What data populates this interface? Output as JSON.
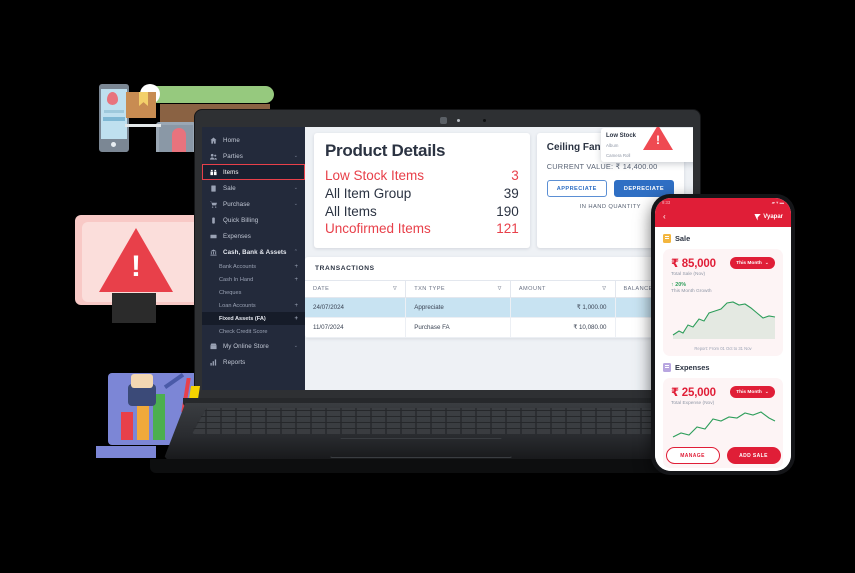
{
  "app": {
    "sidebar": {
      "items": [
        {
          "label": "Home",
          "icon": "home-icon",
          "chevron": ""
        },
        {
          "label": "Parties",
          "icon": "people-icon",
          "chevron": "⌄"
        },
        {
          "label": "Items",
          "icon": "items-icon",
          "chevron": "",
          "selected": true
        },
        {
          "label": "Sale",
          "icon": "sale-icon",
          "chevron": "⌄"
        },
        {
          "label": "Purchase",
          "icon": "cart-icon",
          "chevron": "⌄"
        },
        {
          "label": "Quick Billing",
          "icon": "billing-icon",
          "chevron": ""
        },
        {
          "label": "Expenses",
          "icon": "expenses-icon",
          "chevron": ""
        },
        {
          "label": "Cash, Bank & Assets",
          "icon": "bank-icon",
          "chevron": "⌃",
          "bold": true
        }
      ],
      "subitems": [
        {
          "label": "Bank Accounts",
          "plus": "+"
        },
        {
          "label": "Cash In Hand",
          "plus": "+"
        },
        {
          "label": "Cheques",
          "plus": ""
        },
        {
          "label": "Loan Accounts",
          "plus": "+"
        },
        {
          "label": "Fixed Assets (FA)",
          "plus": "+",
          "active": true
        },
        {
          "label": "Check Credit Score",
          "plus": ""
        }
      ],
      "footer_items": [
        {
          "label": "My Online Store",
          "icon": "store-icon",
          "chevron": "⌄"
        },
        {
          "label": "Reports",
          "icon": "reports-icon",
          "chevron": ""
        }
      ]
    },
    "product_details": {
      "title": "Product Details",
      "stats": [
        {
          "label": "Low Stock Items",
          "value": "3",
          "highlight": true
        },
        {
          "label": "All Item Group",
          "value": "39",
          "highlight": false
        },
        {
          "label": "All Items",
          "value": "190",
          "highlight": false
        },
        {
          "label": "Uncofirmed Items",
          "value": "121",
          "highlight": true
        }
      ]
    },
    "product_card": {
      "name": "Ceiling Fan",
      "current_value": "CURRENT VALUE: ₹ 14,400.00",
      "appreciate_label": "APPRECIATE",
      "depreciate_label": "DEPRECIATE",
      "in_hand_label": "IN HAND QUANTITY"
    },
    "low_stock_popup": {
      "title": "Low Stock",
      "star": "☆",
      "rows": [
        {
          "label": "Album",
          "dots": "⋮"
        },
        {
          "label": "Camera Roll",
          "dots": "⋮"
        }
      ]
    },
    "transactions": {
      "title": "TRANSACTIONS",
      "columns": [
        "DATE",
        "TXN TYPE",
        "AMOUNT",
        "BALANCE"
      ],
      "filter_glyph": "∇",
      "rows": [
        {
          "date": "24/07/2024",
          "type": "Appreciate",
          "amount": "₹ 1,000.00",
          "balance": "",
          "selected": true
        },
        {
          "date": "11/07/2024",
          "type": "Purchase FA",
          "amount": "₹ 10,080.00",
          "balance": "",
          "selected": false
        }
      ]
    }
  },
  "phone": {
    "status": {
      "time": "9:33",
      "icons": "▰ ▾ ▬"
    },
    "header": {
      "back": "‹",
      "brand": "Vyapar"
    },
    "sale": {
      "section_title": "Sale",
      "amount": "₹ 85,000",
      "period_label": "This Month",
      "period_chevron": "⌄",
      "subtitle": "Total Sale (Nov)",
      "growth": "↑ 20%",
      "growth_label": "This Month Growth",
      "report": "Report: From 01 Oct to 31 Nov"
    },
    "expenses": {
      "section_title": "Expenses",
      "amount": "₹ 25,000",
      "period_label": "This Month",
      "period_chevron": "⌄",
      "subtitle": "Total Expense (Nov)"
    },
    "buttons": {
      "manage": "MANAGE",
      "add_sale": "ADD SALE"
    }
  },
  "colors": {
    "brand_red": "#e01e37",
    "alert_red": "#e8404a",
    "sidebar_bg": "#232a3b",
    "primary_blue": "#2f6fc4",
    "chart_green": "#2e9e5b"
  }
}
